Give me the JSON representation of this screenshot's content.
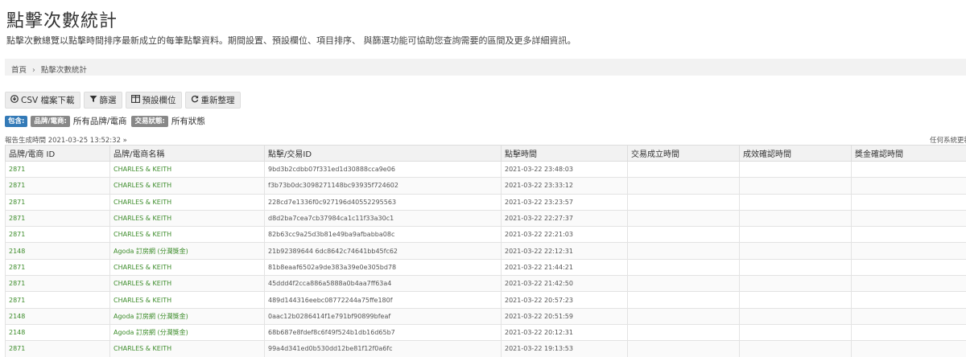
{
  "page": {
    "title": "點擊次數統計",
    "description": "點擊次數總覽以點擊時間排序最新成立的每筆點擊資料。期間設置、預設欄位、項目排序、 與篩選功能可協助您查詢需要的區間及更多詳細資訊。"
  },
  "breadcrumb": {
    "home": "首頁",
    "separator": "›",
    "current": "點擊次數統計"
  },
  "toolbar": {
    "csv": {
      "icon": "download-circle-icon",
      "label": "CSV 檔案下載"
    },
    "filter": {
      "icon": "filter-icon",
      "label": "篩選"
    },
    "columns": {
      "icon": "columns-icon",
      "label": "預設欄位"
    },
    "refresh": {
      "icon": "refresh-icon",
      "label": "重新整理"
    }
  },
  "filters": {
    "include_label": "包含:",
    "brand_label": "品牌/電商:",
    "brand_value": "所有品牌/電商",
    "status_label": "交易狀態:",
    "status_value": "所有狀態"
  },
  "report": {
    "generated_at": "報告生成時間 2021-03-25 13:52:32 »",
    "timezone_note": "任何系統更新"
  },
  "table": {
    "headers": [
      "品牌/電商 ID",
      "品牌/電商名稱",
      "點擊/交易ID",
      "點擊時間",
      "交易成立時間",
      "成效確認時間",
      "獎金確認時間"
    ],
    "rows": [
      [
        "2871",
        "CHARLES & KEITH",
        "9bd3b2cdbb07f331ed1d30888cca9e06",
        "2021-03-22 23:48:03",
        "",
        "",
        ""
      ],
      [
        "2871",
        "CHARLES & KEITH",
        "f3b73b0dc3098271148bc93935f724602",
        "2021-03-22 23:33:12",
        "",
        "",
        ""
      ],
      [
        "2871",
        "CHARLES & KEITH",
        "228cd7e1336f0c927196d40552295563",
        "2021-03-22 23:23:57",
        "",
        "",
        ""
      ],
      [
        "2871",
        "CHARLES & KEITH",
        "d8d2ba7cea7cb37984ca1c11f33a30c1",
        "2021-03-22 22:27:37",
        "",
        "",
        ""
      ],
      [
        "2871",
        "CHARLES & KEITH",
        "82b63cc9a25d3b81e49ba9afbabba08c",
        "2021-03-22 22:21:03",
        "",
        "",
        ""
      ],
      [
        "2148",
        "Agoda 訂房網 (分潤獎金)",
        "21b92389644 6dc8642c74641bb45fc62",
        "2021-03-22 22:12:31",
        "",
        "",
        ""
      ],
      [
        "2871",
        "CHARLES & KEITH",
        "81b8eaaf6502a9de383a39e0e305bd78",
        "2021-03-22 21:44:21",
        "",
        "",
        ""
      ],
      [
        "2871",
        "CHARLES & KEITH",
        "45ddd4f2cca886a5888a0b4aa7ff63a4",
        "2021-03-22 21:42:50",
        "",
        "",
        ""
      ],
      [
        "2871",
        "CHARLES & KEITH",
        "489d144316eebc08772244a75ffe180f",
        "2021-03-22 20:57:23",
        "",
        "",
        ""
      ],
      [
        "2148",
        "Agoda 訂房網 (分潤獎金)",
        "0aac12b0286414f1e791bf90899bfeaf",
        "2021-03-22 20:51:59",
        "",
        "",
        ""
      ],
      [
        "2148",
        "Agoda 訂房網 (分潤獎金)",
        "68b687e8fdef8c6f49f524b1db16d65b7",
        "2021-03-22 20:12:31",
        "",
        "",
        ""
      ],
      [
        "2871",
        "CHARLES & KEITH",
        "99a4d341ed0b530dd12be81f12f0a6fc",
        "2021-03-22 19:13:53",
        "",
        "",
        ""
      ]
    ]
  }
}
